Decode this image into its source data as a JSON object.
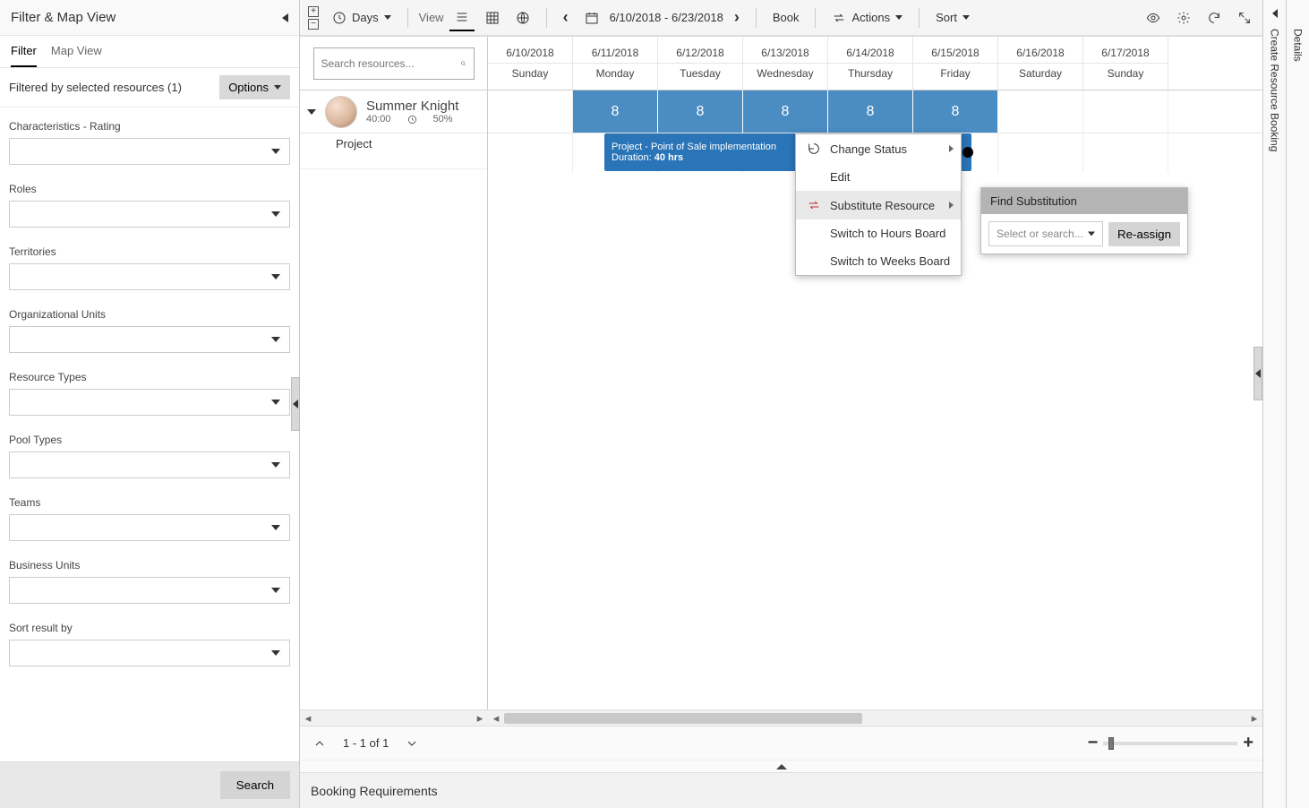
{
  "filterPanel": {
    "title": "Filter & Map View",
    "tabs": {
      "filter": "Filter",
      "map": "Map View"
    },
    "filteredBy": "Filtered by selected resources (1)",
    "optionsLabel": "Options",
    "groups": [
      "Characteristics - Rating",
      "Roles",
      "Territories",
      "Organizational Units",
      "Resource Types",
      "Pool Types",
      "Teams",
      "Business Units",
      "Sort result by"
    ],
    "search": "Search"
  },
  "toolbar": {
    "daysLabel": "Days",
    "viewLabel": "View",
    "dateRange": "6/10/2018 - 6/23/2018",
    "bookLabel": "Book",
    "actionsLabel": "Actions",
    "sortLabel": "Sort"
  },
  "searchResources": {
    "placeholder": "Search resources..."
  },
  "resource": {
    "name": "Summer Knight",
    "hours": "40:00",
    "util": "50%",
    "projectLabel": "Project"
  },
  "calendar": {
    "dates": [
      "6/10/2018",
      "6/11/2018",
      "6/12/2018",
      "6/13/2018",
      "6/14/2018",
      "6/15/2018",
      "6/16/2018",
      "6/17/2018"
    ],
    "dows": [
      "Sunday",
      "Monday",
      "Tuesday",
      "Wednesday",
      "Thursday",
      "Friday",
      "Saturday",
      "Sunday"
    ],
    "hours": [
      "",
      "8",
      "8",
      "8",
      "8",
      "8",
      "",
      ""
    ]
  },
  "projectBar": {
    "line1": "Project - Point of Sale implementation",
    "durationLabel": "Duration: ",
    "durationValue": "40 hrs"
  },
  "contextMenu": {
    "changeStatus": "Change Status",
    "edit": "Edit",
    "substitute": "Substitute Resource",
    "switchHours": "Switch to Hours Board",
    "switchWeeks": "Switch to Weeks Board"
  },
  "subPanel": {
    "title": "Find Substitution",
    "placeholder": "Select or search...",
    "reassign": "Re-assign"
  },
  "rightRail": "Create Resource Booking",
  "detailsRail": "Details",
  "pager": {
    "text": "1 - 1 of 1"
  },
  "bookingReq": "Booking Requirements"
}
